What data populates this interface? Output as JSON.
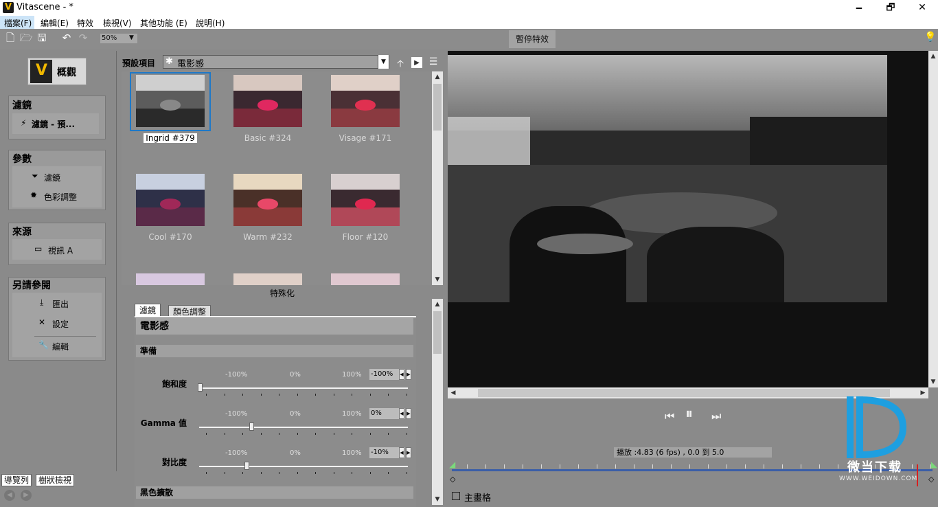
{
  "window": {
    "title": "Vitascene - *",
    "minimize": "🗕",
    "restore": "🗗",
    "close": "✕"
  },
  "menu": [
    "檔案(F)",
    "編輯(E)",
    "特效",
    "檢視(V)",
    "其他功能 (E)",
    "說明(H)"
  ],
  "toolbar": {
    "zoom": "50%",
    "pause_fx": "暫停特效"
  },
  "leftnav": {
    "overview": "概觀",
    "filters_head": "濾鏡",
    "filters_item": "濾鏡 - 預...",
    "params_head": "參數",
    "params_items": [
      "濾鏡",
      "色彩調整"
    ],
    "source_head": "來源",
    "source_item": "視訊 A",
    "seealso_head": "另請參閱",
    "seealso_items": [
      "匯出",
      "設定",
      "編輯"
    ],
    "tabs": [
      "導覽列",
      "樹狀檢視"
    ]
  },
  "presets": {
    "label": "預設項目",
    "selected": "電影感",
    "thumbs": [
      "Ingrid #379",
      "Basic #324",
      "Visage #171",
      "Cool #170",
      "Warm #232",
      "Floor #120"
    ],
    "footer": "特殊化"
  },
  "params": {
    "tabs": [
      "濾鏡",
      "顏色調整"
    ],
    "title": "電影感",
    "section1": "準備",
    "scale": [
      "-100%",
      "0%",
      "100%"
    ],
    "rows": [
      {
        "name": "飽和度",
        "value": "-100%",
        "level": -100
      },
      {
        "name": "Gamma 值",
        "value": "0%",
        "level": 0
      },
      {
        "name": "對比度",
        "value": "-10%",
        "level": -10
      }
    ],
    "section2": "黑色擴散"
  },
  "transport": {
    "prev": "⏮",
    "pause": "⏸",
    "next": "⏭",
    "fps": "播放 :4.83 (6  fps) , 0.0 到  5.0",
    "main_grid": "主畫格"
  },
  "watermark": {
    "text": "微当下载",
    "url": "WWW.WEIDOWN.COM"
  }
}
